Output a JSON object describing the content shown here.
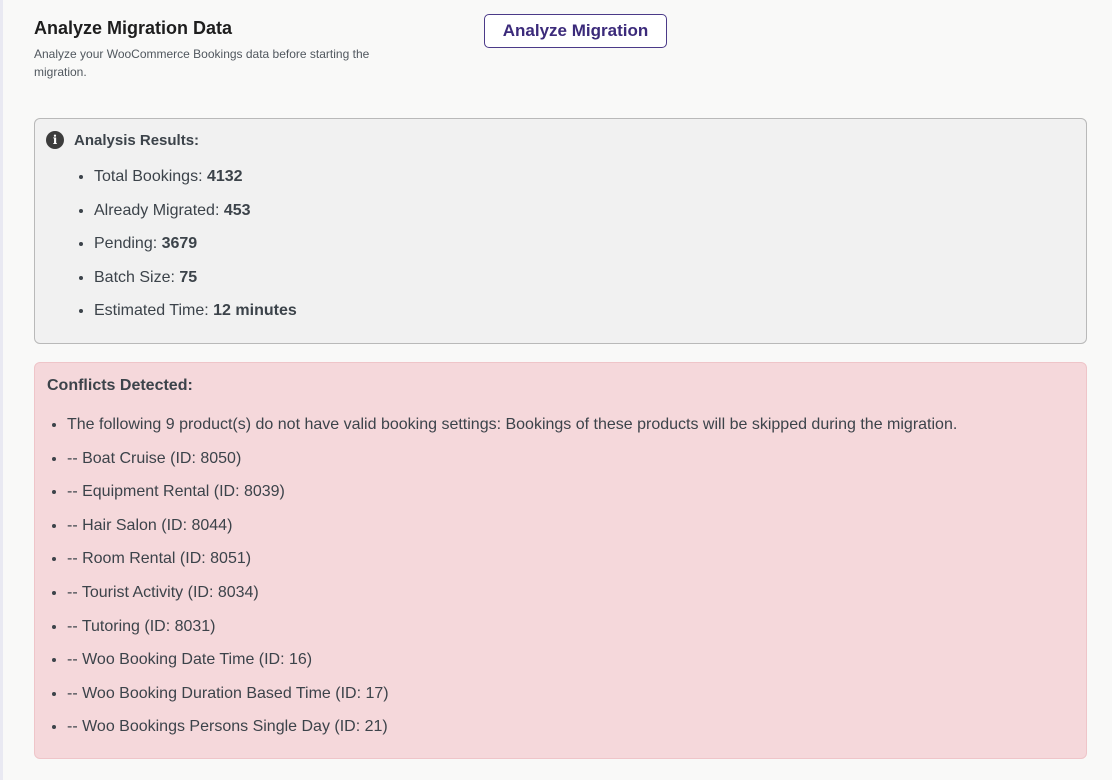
{
  "header": {
    "title": "Analyze Migration Data",
    "description": "Analyze your WooCommerce Bookings data before starting the migration.",
    "analyze_button": "Analyze Migration"
  },
  "results": {
    "title": "Analysis Results:",
    "icon": "info-icon",
    "items": [
      {
        "label": "Total Bookings: ",
        "value": "4132"
      },
      {
        "label": "Already Migrated: ",
        "value": "453"
      },
      {
        "label": "Pending: ",
        "value": "3679"
      },
      {
        "label": "Batch Size: ",
        "value": "75"
      },
      {
        "label": "Estimated Time: ",
        "value": "12 minutes"
      }
    ]
  },
  "conflicts": {
    "title": "Conflicts Detected:",
    "items": [
      "The following 9 product(s) do not have valid booking settings: Bookings of these products will be skipped during the migration.",
      "-- Boat Cruise (ID: 8050)",
      "-- Equipment Rental (ID: 8039)",
      "-- Hair Salon (ID: 8044)",
      "-- Room Rental (ID: 8051)",
      "-- Tourist Activity (ID: 8034)",
      "-- Tutoring (ID: 8031)",
      "-- Woo Booking Date Time (ID: 16)",
      "-- Woo Booking Duration Based Time (ID: 17)",
      "-- Woo Bookings Persons Single Day (ID: 21)"
    ]
  },
  "colors": {
    "accent": "#3b2a7a",
    "results_bg": "#f1f1f1",
    "conflicts_bg": "#f5d8db"
  }
}
